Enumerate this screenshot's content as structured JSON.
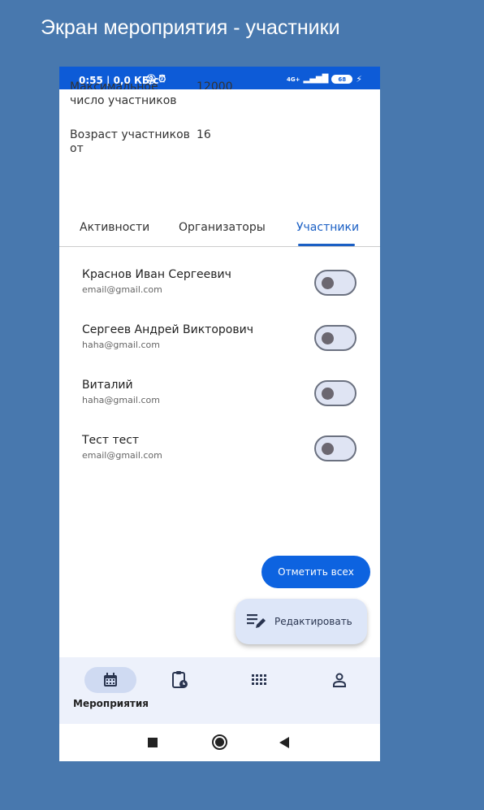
{
  "slide": {
    "title": "Экран мероприятия - участники"
  },
  "status_bar": {
    "time": "0:55 | 0,0 КБ/с",
    "network": "4G+",
    "battery": "68"
  },
  "info_rows": [
    {
      "label": "Максимальное число участников",
      "value": "12000"
    },
    {
      "label": "Возраст участников от",
      "value": "16"
    }
  ],
  "tabs": [
    "Активности",
    "Организаторы",
    "Участники"
  ],
  "active_tab": "Участники",
  "participants": [
    {
      "name": "Краснов Иван Сергеевич",
      "email": "email@gmail.com",
      "checked": false
    },
    {
      "name": "Сергеев Андрей Викторович",
      "email": "haha@gmail.com",
      "checked": false
    },
    {
      "name": "Виталий",
      "email": "haha@gmail.com",
      "checked": false
    },
    {
      "name": "Тест тест",
      "email": "email@gmail.com",
      "checked": false
    }
  ],
  "actions": {
    "mark_all": "Отметить всех",
    "edit": "Редактировать"
  },
  "bottom_nav": [
    {
      "icon": "calendar-icon",
      "label": "Мероприятия",
      "active": true
    },
    {
      "icon": "clipboard-clock-icon",
      "label": "",
      "active": false
    },
    {
      "icon": "grid-icon",
      "label": "",
      "active": false
    },
    {
      "icon": "person-icon",
      "label": "",
      "active": false
    }
  ],
  "system_nav": [
    "recents-button",
    "home-button",
    "back-button"
  ],
  "colors": {
    "background": "#4878ae",
    "status_bar": "#0d5bd7",
    "accent": "#1a5fc4",
    "button": "#0d63e0",
    "nav_bg": "#edf1fb"
  }
}
